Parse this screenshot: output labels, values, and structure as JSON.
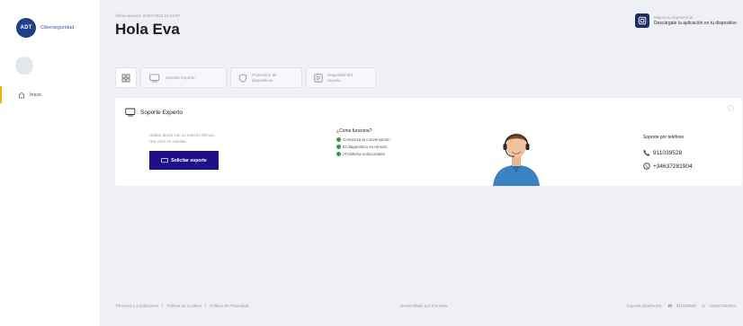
{
  "brand": {
    "logo_text": "ADT",
    "label": "Ciberseguridad",
    "color": "#1f3e8c"
  },
  "sidebar": {
    "items": [
      {
        "label": "Inicio",
        "icon": "home-icon",
        "active": true
      }
    ]
  },
  "header": {
    "last_access": "Último acceso: 20/07/2021 16:14:07",
    "greeting": "Hola Eva",
    "promo_line1": "Mejora tu experiencia",
    "promo_line2": "Descárgate la aplicación en tu dispositivo"
  },
  "tabs": [
    {
      "label": "",
      "icon": "grid-icon"
    },
    {
      "label": "Soporte Experto",
      "icon": "monitor-chat-icon"
    },
    {
      "label": "Protección de dispositivos",
      "icon": "shield-icon"
    },
    {
      "label": "Seguridad del usuario",
      "icon": "id-card-icon"
    }
  ],
  "card": {
    "title": "Soporte Experto",
    "intro_line1": "Hablar ahora con un experto técnico.",
    "intro_line2": "Haz click en solicitar.",
    "button": "Solicitar soporte",
    "how_title": "¿Cómo funciona?",
    "steps": [
      "Comienza la conversación",
      "El diagnóstico es remoto",
      "¡Problema solucionado!"
    ],
    "phone_title": "Soporte por teléfono",
    "phone": "911039528",
    "whatsapp": "+34637281904",
    "accent": "#1f0f8a"
  },
  "footer": {
    "links": [
      "Términos y Condiciones",
      "|",
      "Política de Cookies",
      "|",
      "Política de Privacidad"
    ],
    "developer": "Desarrollado por Frontalia",
    "support_label": "Soporte plataforma:",
    "phone": "911039528",
    "whatsapp": "+34637281904"
  }
}
